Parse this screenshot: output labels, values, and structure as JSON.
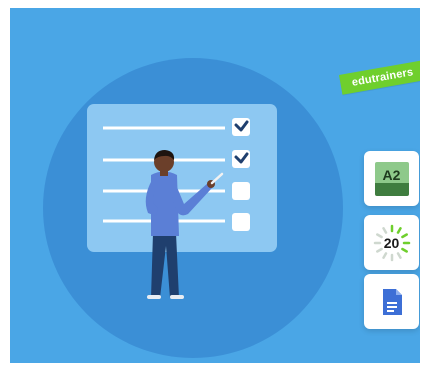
{
  "brand": {
    "name": "edutrainers",
    "ribbon_color": "#6fcf2d"
  },
  "colors": {
    "panel_background": "#4aa6e6",
    "circle": "#3b8fd6",
    "board": "#8dc8f2",
    "line": "#ffffff"
  },
  "checklist": {
    "items": [
      {
        "checked": true
      },
      {
        "checked": true
      },
      {
        "checked": false
      },
      {
        "checked": false
      }
    ]
  },
  "side_cards": [
    {
      "icon": "language-level-icon",
      "label": "A2"
    },
    {
      "icon": "timer-icon",
      "label": "20"
    },
    {
      "icon": "document-icon",
      "label": ""
    }
  ]
}
